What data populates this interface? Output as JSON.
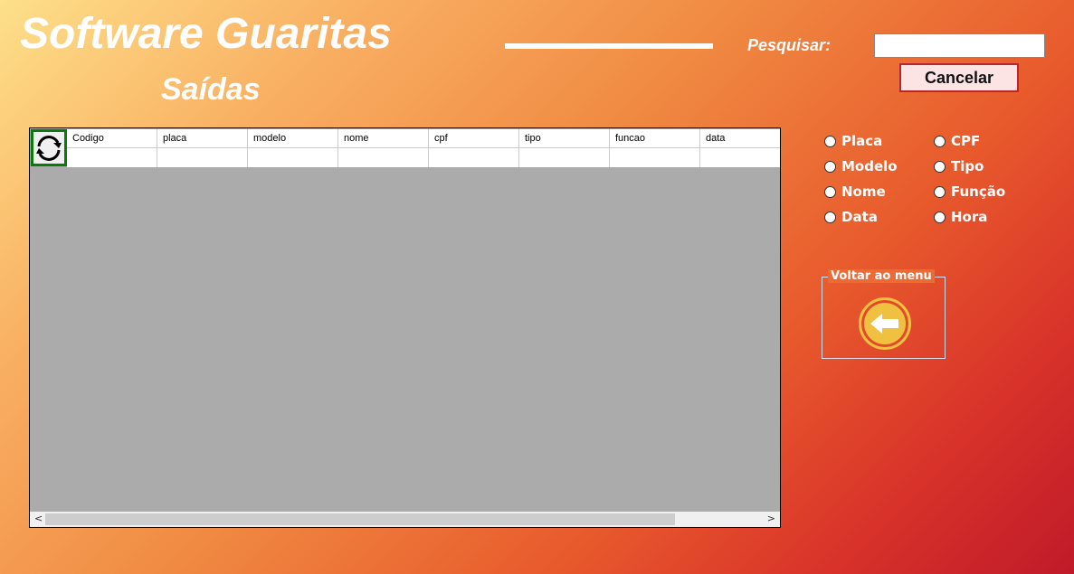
{
  "header": {
    "title": "Software Guaritas",
    "subtitle": "Saídas"
  },
  "search": {
    "label": "Pesquisar:",
    "value": "",
    "cancel_label": "Cancelar"
  },
  "grid": {
    "columns": [
      "Codigo",
      "placa",
      "modelo",
      "nome",
      "cpf",
      "tipo",
      "funcao",
      "data"
    ],
    "scroll_left": "<",
    "scroll_right": ">"
  },
  "filters": [
    "Placa",
    "Modelo",
    "Nome",
    "Data",
    "CPF",
    "Tipo",
    "Função",
    "Hora"
  ],
  "back": {
    "label": "Voltar ao menu"
  }
}
